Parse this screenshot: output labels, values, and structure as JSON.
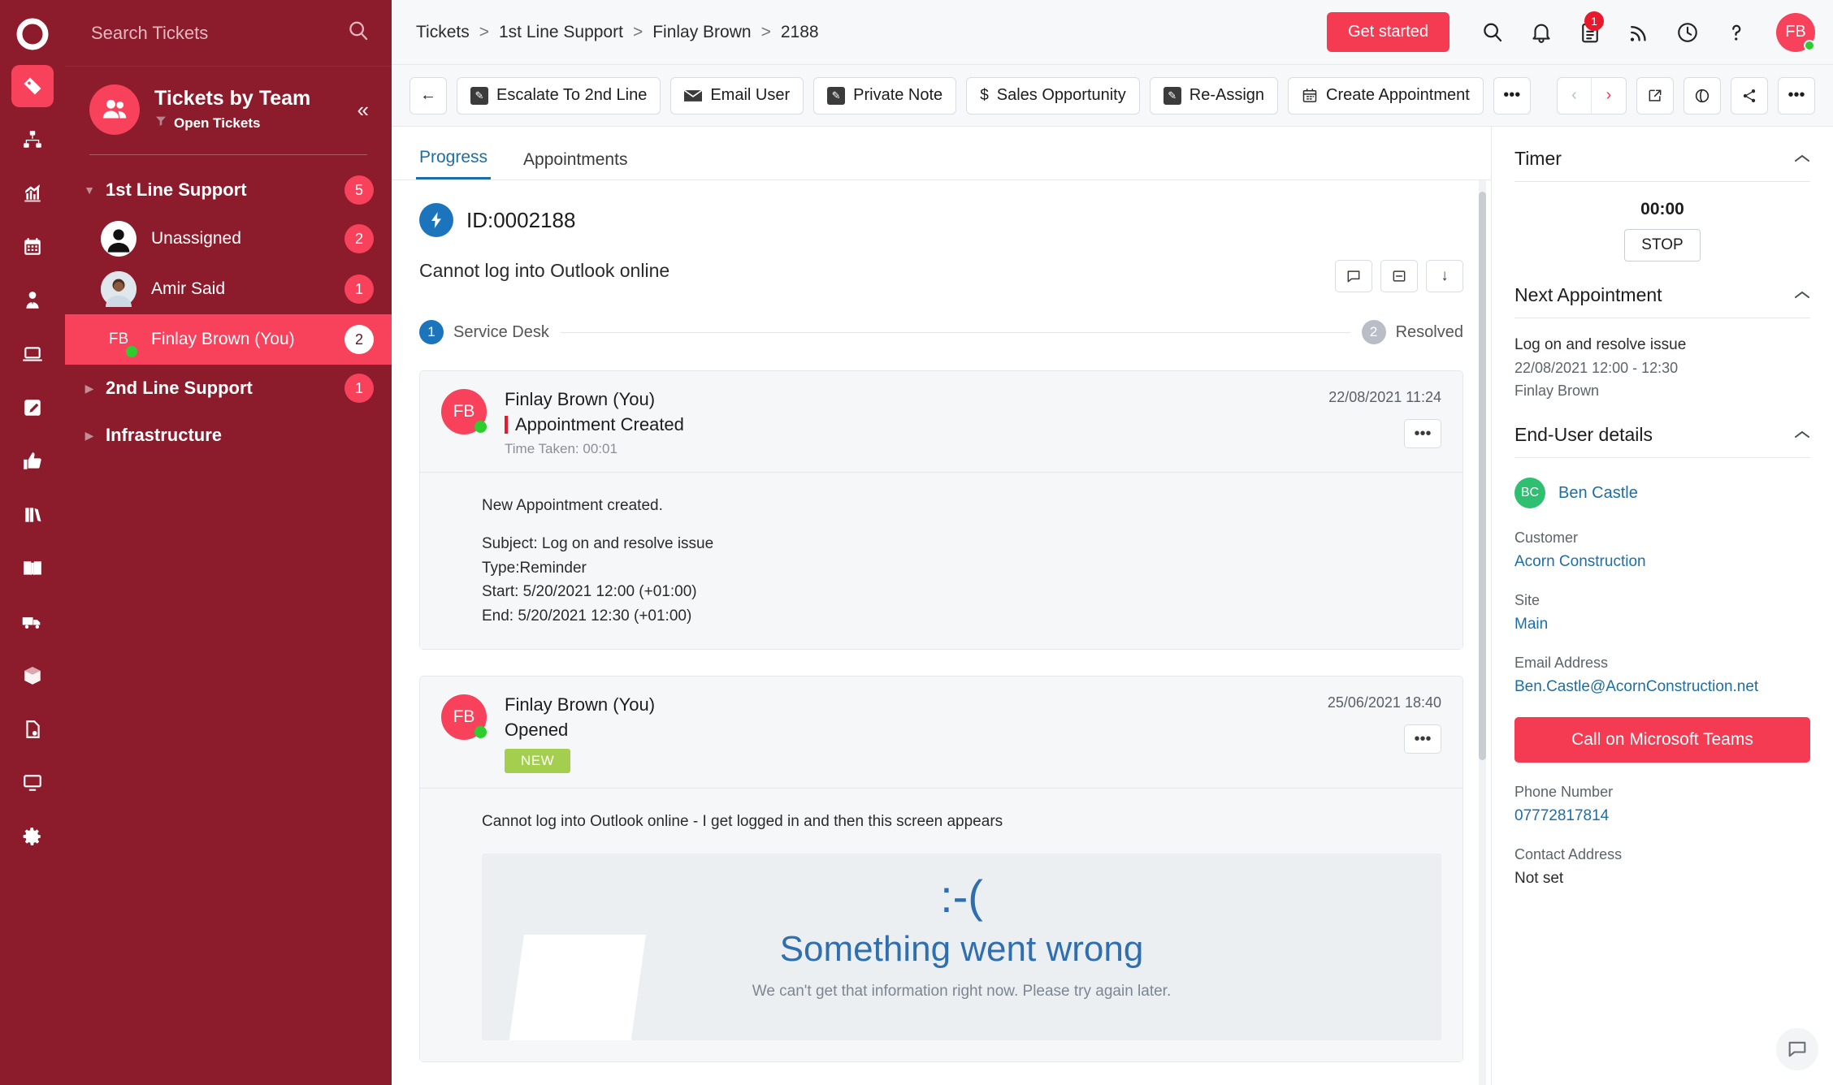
{
  "rail": {
    "logo": "halo-logo-icon",
    "items": [
      {
        "name": "ticket-icon",
        "active": true
      },
      {
        "name": "org-chart-icon",
        "active": false
      },
      {
        "name": "reports-chart-icon",
        "active": false
      },
      {
        "name": "calendar-icon",
        "active": false
      },
      {
        "name": "user-tie-icon",
        "active": false
      },
      {
        "name": "laptop-icon",
        "active": false
      },
      {
        "name": "edit-note-icon",
        "active": false
      },
      {
        "name": "thumbs-up-icon",
        "active": false
      },
      {
        "name": "books-icon",
        "active": false
      },
      {
        "name": "open-book-icon",
        "active": false
      },
      {
        "name": "truck-icon",
        "active": false
      },
      {
        "name": "box-icon",
        "active": false
      },
      {
        "name": "quote-document-icon",
        "active": false
      },
      {
        "name": "monitor-icon",
        "active": false
      },
      {
        "name": "settings-gear-icon",
        "active": false
      }
    ]
  },
  "tickets_panel": {
    "search": {
      "placeholder": "Search Tickets",
      "value": ""
    },
    "title": "Tickets by Team",
    "filter_label": "Open Tickets",
    "collapse_label": "«",
    "tree": [
      {
        "type": "group",
        "label": "1st Line Support",
        "count": "5",
        "expanded": true,
        "caret": "▼"
      },
      {
        "type": "agent",
        "label": "Unassigned",
        "count": "2",
        "initials": "",
        "avatar": "unassigned",
        "selected": false,
        "online": false
      },
      {
        "type": "agent",
        "label": "Amir Said",
        "count": "1",
        "initials": "",
        "avatar": "photo",
        "selected": false,
        "online": false
      },
      {
        "type": "agent",
        "label": "Finlay Brown (You)",
        "count": "2",
        "initials": "FB",
        "avatar": "fb",
        "selected": true,
        "online": true
      },
      {
        "type": "group",
        "label": "2nd Line Support",
        "count": "1",
        "expanded": false,
        "caret": "▶"
      },
      {
        "type": "group",
        "label": "Infrastructure",
        "count": "",
        "expanded": false,
        "caret": "▶"
      }
    ]
  },
  "topbar": {
    "breadcrumbs": [
      "Tickets",
      "1st Line Support",
      "Finlay Brown",
      "2188"
    ],
    "separator": ">",
    "get_started_label": "Get started",
    "icons": [
      {
        "name": "search-icon",
        "badge": ""
      },
      {
        "name": "bell-notification-icon",
        "badge": ""
      },
      {
        "name": "clipboard-tasks-icon",
        "badge": "1"
      },
      {
        "name": "rss-feed-icon",
        "badge": ""
      },
      {
        "name": "clock-history-icon",
        "badge": ""
      },
      {
        "name": "help-question-icon",
        "badge": ""
      }
    ],
    "avatar_initials": "FB"
  },
  "actionbar": {
    "back_label": "←",
    "buttons": [
      {
        "label": "Escalate To 2nd Line",
        "icon": "pencil-square-icon"
      },
      {
        "label": "Email User",
        "icon": "envelope-icon"
      },
      {
        "label": "Private Note",
        "icon": "pencil-square-icon"
      },
      {
        "label": "Sales Opportunity",
        "icon": "dollar-icon"
      },
      {
        "label": "Re-Assign",
        "icon": "pencil-square-icon"
      },
      {
        "label": "Create Appointment",
        "icon": "calendar-icon"
      }
    ],
    "overflow_label": "•••",
    "right": {
      "prev_label": "‹",
      "next_label": "›",
      "popout_label": "↗",
      "watch_label": "◉",
      "share_label": "share-icon",
      "more_label": "•••"
    }
  },
  "ticket": {
    "tabs": [
      {
        "label": "Progress",
        "active": true
      },
      {
        "label": "Appointments",
        "active": false
      }
    ],
    "id_text": "ID:0002188",
    "title": "Cannot log into Outlook online",
    "title_actions": [
      {
        "name": "comment-icon",
        "glyph": "🗪"
      },
      {
        "name": "collapse-box-icon",
        "glyph": "⊟"
      },
      {
        "name": "arrow-down-icon",
        "glyph": "↓"
      }
    ],
    "steps": [
      {
        "num": "1",
        "label": "Service Desk",
        "state": "blue"
      },
      {
        "num": "2",
        "label": "Resolved",
        "state": "grey"
      }
    ],
    "entries": [
      {
        "author": "Finlay Brown (You)",
        "initials": "FB",
        "action": "Appointment Created",
        "time_taken": "Time Taken: 00:01",
        "date": "22/08/2021 11:24",
        "tag": "",
        "body": [
          "New Appointment created.",
          "",
          "Subject: Log on and resolve issue",
          "Type:Reminder",
          "Start: 5/20/2021 12:00 (+01:00)",
          "End: 5/20/2021 12:30 (+01:00)"
        ]
      },
      {
        "author": "Finlay Brown (You)",
        "initials": "FB",
        "action": "Opened",
        "time_taken": "",
        "date": "25/06/2021 18:40",
        "tag": "NEW",
        "body": [
          "Cannot log into Outlook online - I get logged in and then this screen appears"
        ],
        "screenshot": {
          "face": ":-(",
          "headline": "Something went wrong",
          "subtext": "We can't get that information right now. Please try again later."
        }
      }
    ]
  },
  "right_panel": {
    "timer": {
      "title": "Timer",
      "value": "00:00",
      "stop_label": "STOP"
    },
    "next_appointment": {
      "title": "Next Appointment",
      "subject": "Log on and resolve issue",
      "when": "22/08/2021 12:00 - 12:30",
      "who": "Finlay Brown"
    },
    "end_user": {
      "title": "End-User details",
      "name": "Ben Castle",
      "initials": "BC",
      "fields": [
        {
          "label": "Customer",
          "value": "Acorn Construction",
          "link": true
        },
        {
          "label": "Site",
          "value": "Main",
          "link": true
        }
      ],
      "email_label": "Email Address",
      "email_value": "Ben.Castle@AcornConstruction.net",
      "teams_button": "Call on Microsoft Teams",
      "phone_label": "Phone Number",
      "phone_value": "07772817814",
      "contact_label": "Contact Address",
      "contact_value": "Not set"
    },
    "chevron": "⌃"
  },
  "colors": {
    "brand_dark": "#8C1B2B",
    "brand_accent": "#F8415A",
    "cta_red": "#F43B52",
    "link_blue": "#1C6EA4",
    "tag_green": "#A3CE4E",
    "online_green": "#2ECC2E"
  }
}
